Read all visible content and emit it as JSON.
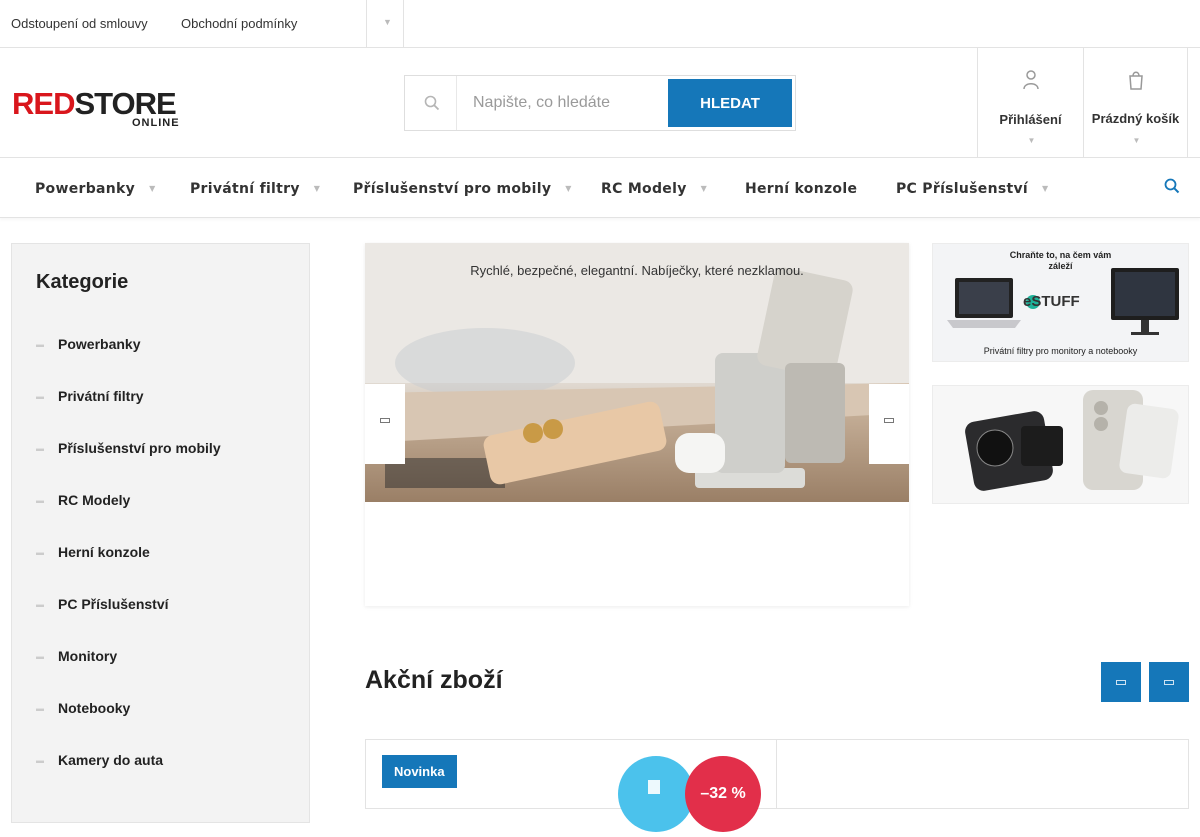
{
  "topbar": {
    "links": [
      "Odstoupení od smlouvy",
      "Obchodní podmínky"
    ]
  },
  "logo": {
    "part1": "RED",
    "part2": "STORE",
    "part3": "ONLINE"
  },
  "search": {
    "placeholder": "Napište, co hledáte",
    "button": "HLEDAT"
  },
  "account": {
    "login_label": "Přihlášení",
    "cart_label": "Prázdný košík"
  },
  "nav": {
    "items": [
      "Powerbanky",
      "Privátní filtry",
      "Příslušenství pro mobily",
      "RC Modely",
      "Herní konzole",
      "PC Příslušenství"
    ]
  },
  "sidebar": {
    "title": "Kategorie",
    "items": [
      "Powerbanky",
      "Privátní filtry",
      "Příslušenství pro mobily",
      "RC Modely",
      "Herní konzole",
      "PC Příslušenství",
      "Monitory",
      "Notebooky",
      "Kamery do auta"
    ]
  },
  "banner": {
    "caption": "Rychlé, bezpečné, elegantní. Nabíječky, které nezklamou."
  },
  "side_banner_1": {
    "title": "Chraňte to, na čem vám záleží",
    "brand": "eSTUFF",
    "subtitle": "Privátní filtry pro monitory a notebooky"
  },
  "section": {
    "title": "Akční zboží"
  },
  "product": {
    "badge": "Novinka",
    "discount": "–32 %"
  },
  "colors": {
    "accent": "#1577b9",
    "brand_red": "#d9161c",
    "discount_red": "#e22f4a",
    "badge_cyan": "#4bc2ec"
  }
}
